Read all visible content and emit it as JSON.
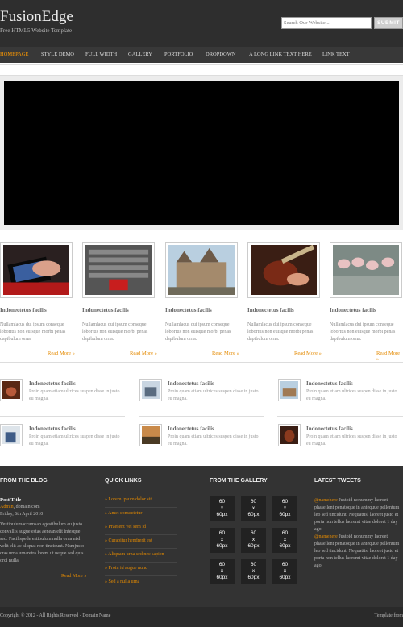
{
  "header": {
    "logo": "FusionEdge",
    "tagline": "Free HTML5 Website Template",
    "search_placeholder": "Search Our Website ...",
    "search_button": "SUBMIT"
  },
  "nav": [
    "HOMEPAGE",
    "STYLE DEMO",
    "FULL WIDTH",
    "GALLERY",
    "PORTFOLIO",
    "DROPDOWN",
    "A LONG LINK TEXT HERE",
    "LINK TEXT"
  ],
  "cards": [
    {
      "title": "Indonectetus facilis",
      "body": "Nullamlacus dui ipsum conseque loborttis non euisque morbi penas dapibulum orna.",
      "link": "Read More »"
    },
    {
      "title": "Indonectetus facilis",
      "body": "Nullamlacus dui ipsum conseque loborttis non euisque morbi penas dapibulum orna.",
      "link": "Read More »"
    },
    {
      "title": "Indonectetus facilis",
      "body": "Nullamlacus dui ipsum conseque loborttis non euisque morbi penas dapibulum orna.",
      "link": "Read More »"
    },
    {
      "title": "Indonectetus facilis",
      "body": "Nullamlacus dui ipsum conseque loborttis non euisque morbi penas dapibulum orna.",
      "link": "Read More »"
    },
    {
      "title": "Indonectetus facilis",
      "body": "Nullamlacus dui ipsum conseque loborttis non euisque morbi penas dapibulum orna.",
      "link": "Read More »"
    }
  ],
  "small_items": [
    {
      "title": "Indonectetus facilis",
      "body": "Proin quam etiam ultrices suspen disse in justo eu magna."
    },
    {
      "title": "Indonectetus facilis",
      "body": "Proin quam etiam ultrices suspen disse in justo eu magna."
    },
    {
      "title": "Indonectetus facilis",
      "body": "Proin quam etiam ultrices suspen disse in justo eu magna."
    },
    {
      "title": "Indonectetus facilis",
      "body": "Proin quam etiam ultrices suspen disse in justo eu magna."
    },
    {
      "title": "Indonectetus facilis",
      "body": "Proin quam etiam ultrices suspen disse in justo eu magna."
    },
    {
      "title": "Indonectetus facilis",
      "body": "Proin quam etiam ultrices suspen disse in justo eu magna."
    }
  ],
  "footer": {
    "blog_heading": "FROM THE BLOG",
    "post_title": "Post Title",
    "post_author": "Admin",
    "post_domain": ", domain.com",
    "post_date": "Friday, 6th April 2010",
    "post_body": "Vestibulumaccumsan egestibulum eu justo convallis augue estas aenean elit intesque sed. Facilispede estibulum nulla orna nisl velit elit ac aliquat non tincidunt. Namjusto cras urna urnaretra lorem ut neque sed quis orci nulla.",
    "post_link": "Read More »",
    "ql_heading": "QUICK LINKS",
    "quick_links": [
      "» Lorem ipsum dolor sit",
      "» Amet consectetur",
      "» Praesent vel sem id",
      "» Curabitur hendrerit est",
      "» Aliquam urna sed nec sapien",
      "» Proin id augue nunc",
      "» Sed a nulla urna"
    ],
    "gallery_heading": "FROM THE GALLERY",
    "gallery_cell": [
      "60",
      "x",
      "60px"
    ],
    "tweets_heading": "LATEST TWEETS",
    "tweets": [
      {
        "user": "@namehere",
        "text": " Justoid nonummy laoreet phasellent penatoque in antequue pellentum leo sed tincidunt. Nequattisl laoreet justo et porta non tellus laoremt vitae doloret 1 day ago"
      },
      {
        "user": "@namehere",
        "text": " Justoid nonummy laoreet phasellent penatoque in antequue pellentum leo sed tincidunt. Nequattisl laoreet justo et porta non tellus laoremt vitae doloret 1 day ago"
      }
    ]
  },
  "copyright_left": "Copyright © 2012 - All Rights Reserved - Domain Name",
  "copyright_right": "Template from"
}
